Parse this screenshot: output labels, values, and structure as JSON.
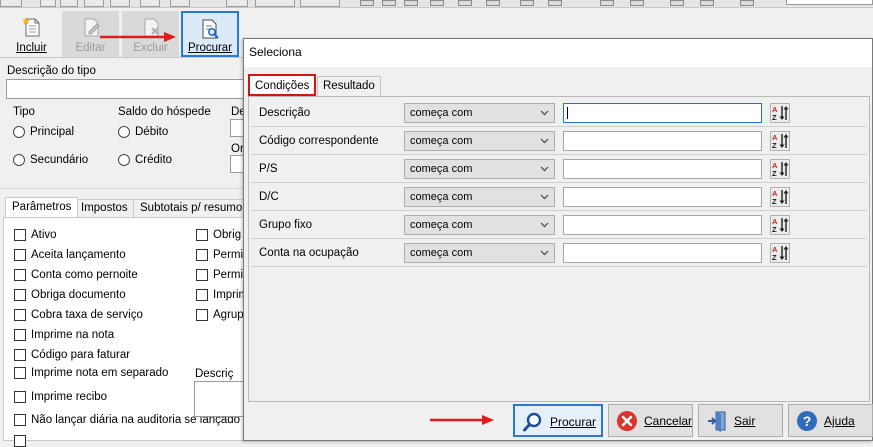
{
  "toolbar": {
    "incluir": "Incluir",
    "editar": "Editar",
    "excluir": "Excluir",
    "procurar": "Procurar"
  },
  "form": {
    "descricao_tipo": "Descrição do tipo",
    "tipo_label": "Tipo",
    "tipo_principal": "Principal",
    "tipo_secundario": "Secundário",
    "saldo_label": "Saldo do hóspede",
    "saldo_debito": "Débito",
    "saldo_credito": "Crédito",
    "cut_de": "De",
    "cut_or": "Or",
    "descricao_short": "Descriç",
    "tabs": [
      "Parâmetros",
      "Impostos",
      "Subtotais p/ resumo"
    ],
    "checks_left": [
      "Ativo",
      "Aceita lançamento",
      "Conta como pernoite",
      "Obriga documento",
      "Cobra taxa de serviço",
      "Imprime na nota",
      "Código para faturar",
      "Imprime nota em separado",
      "Imprime recibo",
      "Não lançar diária na auditoria se lançado"
    ],
    "checks_right": [
      "Obrig",
      "Permi",
      "Permi",
      "Imprim",
      "Agrup"
    ]
  },
  "dialog": {
    "title": "Seleciona",
    "tabs": [
      "Condições",
      "Resultado"
    ],
    "condition_default": "começa com",
    "fields": [
      {
        "name": "Descrição",
        "condition": "começa com",
        "value": ""
      },
      {
        "name": "Código correspondente",
        "condition": "começa com",
        "value": ""
      },
      {
        "name": "P/S",
        "condition": "começa com",
        "value": ""
      },
      {
        "name": "D/C",
        "condition": "começa com",
        "value": ""
      },
      {
        "name": "Grupo fixo",
        "condition": "começa com",
        "value": ""
      },
      {
        "name": "Conta na ocupação",
        "condition": "começa com",
        "value": ""
      }
    ],
    "buttons": {
      "procurar": "Procurar",
      "cancelar": "Cancelar",
      "sair": "Sair",
      "ajuda": "Ajuda"
    }
  },
  "colors": {
    "highlight_red": "#d41313",
    "accent_blue": "#2b78d0",
    "cancel_red": "#d9342b",
    "help_blue": "#2e6bb8"
  },
  "icons": {
    "incluir": "new-document-icon",
    "editar": "edit-document-icon",
    "excluir": "delete-document-icon",
    "procurar": "search-document-icon",
    "sort": "sort-az-icon",
    "btn_procurar": "magnifier-icon",
    "btn_cancelar": "cancel-icon",
    "btn_sair": "exit-door-icon",
    "btn_ajuda": "help-icon"
  }
}
